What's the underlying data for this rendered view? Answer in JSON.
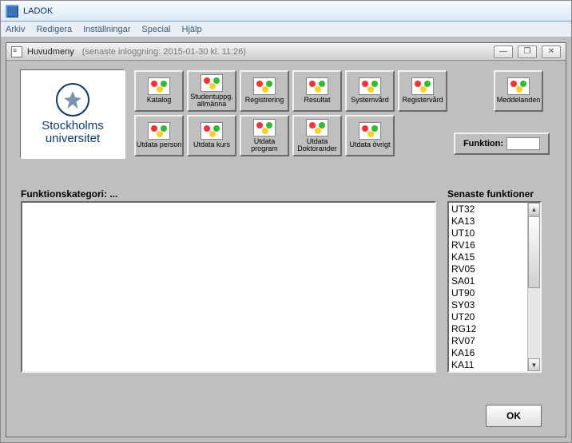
{
  "window": {
    "title": "LADOK"
  },
  "menu": {
    "arkiv": "Arkiv",
    "redigera": "Redigera",
    "installningar": "Inställningar",
    "special": "Special",
    "hjalp": "Hjälp"
  },
  "inner": {
    "title": "Huvudmeny",
    "subtitle": "(senaste inloggning:  2015-01-30 kl. 11:26)",
    "min": "—",
    "max": "❐",
    "close": "✕"
  },
  "logo": {
    "line1": "Stockholms",
    "line2": "universitet"
  },
  "toolbar": {
    "row1": [
      {
        "label": "Katalog"
      },
      {
        "label": "Studentuppg. allmänna"
      },
      {
        "label": "Registrering"
      },
      {
        "label": "Resultat"
      },
      {
        "label": "Systemvård"
      },
      {
        "label": "Registervård"
      }
    ],
    "row2": [
      {
        "label": "Utdata person"
      },
      {
        "label": "Utdata kurs"
      },
      {
        "label": "Utdata program"
      },
      {
        "label": "Utdata Doktorander"
      },
      {
        "label": "Utdata övrigt"
      }
    ],
    "meddelanden": "Meddelanden"
  },
  "funktion": {
    "label": "Funktion:",
    "value": ""
  },
  "labels": {
    "funkkategori": "Funktionskategori:  ...",
    "senaste": "Senaste funktioner"
  },
  "recent": [
    "UT32",
    "KA13",
    "UT10",
    "RV16",
    "KA15",
    "RV05",
    "SA01",
    "UT90",
    "SY03",
    "UT20",
    "RG12",
    "RV07",
    "KA16",
    "KA11"
  ],
  "ok": "OK"
}
